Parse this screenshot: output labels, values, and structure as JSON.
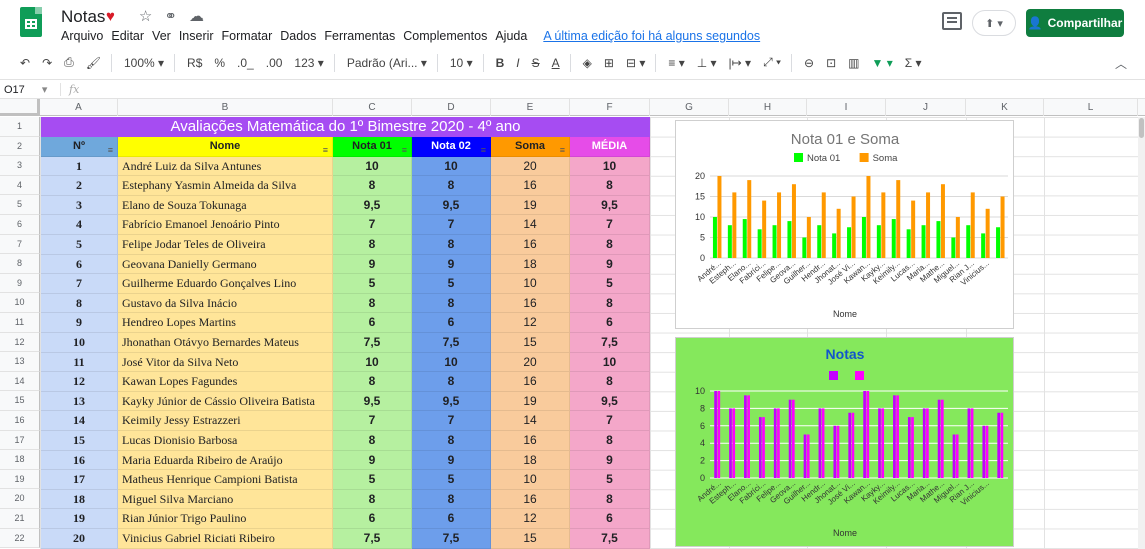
{
  "app": {
    "doc_title": "Notas",
    "menu": [
      "Arquivo",
      "Editar",
      "Ver",
      "Inserir",
      "Formatar",
      "Dados",
      "Ferramentas",
      "Complementos",
      "Ajuda"
    ],
    "last_edit": "A última edição foi há alguns segundos",
    "share_label": "Compartilhar"
  },
  "toolbar": {
    "zoom": "100%",
    "currency": "R$",
    "percent": "%",
    "dec_less": ".0_",
    "dec_more": ".00",
    "format_123": "123",
    "font": "Padrão (Ari...",
    "font_size": "10",
    "bold": "B",
    "italic": "I",
    "strike": "S",
    "underline_a": "A"
  },
  "formula_bar": {
    "cell_ref": "O17",
    "fx": "fx",
    "value": ""
  },
  "grid": {
    "columns": [
      "A",
      "B",
      "C",
      "D",
      "E",
      "F",
      "G",
      "H",
      "I",
      "J",
      "K",
      "L"
    ],
    "rows": [
      "1",
      "2",
      "3",
      "4",
      "5",
      "6",
      "7",
      "8",
      "9",
      "10",
      "11",
      "12",
      "13",
      "14",
      "15",
      "16",
      "17",
      "18",
      "19",
      "20",
      "21",
      "22"
    ]
  },
  "sheet": {
    "title": "Avaliações Matemática do 1º Bimestre 2020 -  4º ano",
    "headers": [
      "Nº",
      "Nome",
      "Nota 01",
      "Nota 02",
      "Soma",
      "MÉDIA"
    ],
    "students": [
      {
        "n": "1",
        "nome": "André Luiz da Silva Antunes",
        "n1": "10",
        "n2": "10",
        "soma": "20",
        "media": "10"
      },
      {
        "n": "2",
        "nome": "Estephany Yasmin Almeida da Silva",
        "n1": "8",
        "n2": "8",
        "soma": "16",
        "media": "8"
      },
      {
        "n": "3",
        "nome": "Elano de Souza Tokunaga",
        "n1": "9,5",
        "n2": "9,5",
        "soma": "19",
        "media": "9,5"
      },
      {
        "n": "4",
        "nome": "Fabrício Emanoel Jenoário Pinto",
        "n1": "7",
        "n2": "7",
        "soma": "14",
        "media": "7"
      },
      {
        "n": "5",
        "nome": "Felipe Jodar Teles de Oliveira",
        "n1": "8",
        "n2": "8",
        "soma": "16",
        "media": "8"
      },
      {
        "n": "6",
        "nome": "Geovana Danielly Germano",
        "n1": "9",
        "n2": "9",
        "soma": "18",
        "media": "9"
      },
      {
        "n": "7",
        "nome": "Guilherme Eduardo Gonçalves Lino",
        "n1": "5",
        "n2": "5",
        "soma": "10",
        "media": "5"
      },
      {
        "n": "8",
        "nome": "Gustavo da Silva Inácio",
        "n1": "8",
        "n2": "8",
        "soma": "16",
        "media": "8"
      },
      {
        "n": "9",
        "nome": "Hendreo Lopes Martins",
        "n1": "6",
        "n2": "6",
        "soma": "12",
        "media": "6"
      },
      {
        "n": "10",
        "nome": "Jhonathan Otávyo Bernardes Mateus",
        "n1": "7,5",
        "n2": "7,5",
        "soma": "15",
        "media": "7,5"
      },
      {
        "n": "11",
        "nome": "José Vitor da Silva Neto",
        "n1": "10",
        "n2": "10",
        "soma": "20",
        "media": "10"
      },
      {
        "n": "12",
        "nome": "Kawan Lopes Fagundes",
        "n1": "8",
        "n2": "8",
        "soma": "16",
        "media": "8"
      },
      {
        "n": "13",
        "nome": "Kayky Júnior de Cássio Oliveira Batista",
        "n1": "9,5",
        "n2": "9,5",
        "soma": "19",
        "media": "9,5"
      },
      {
        "n": "14",
        "nome": "Keimily Jessy Estrazzeri",
        "n1": "7",
        "n2": "7",
        "soma": "14",
        "media": "7"
      },
      {
        "n": "15",
        "nome": "Lucas Dionisio Barbosa",
        "n1": "8",
        "n2": "8",
        "soma": "16",
        "media": "8"
      },
      {
        "n": "16",
        "nome": "Maria Eduarda Ribeiro de Araújo",
        "n1": "9",
        "n2": "9",
        "soma": "18",
        "media": "9"
      },
      {
        "n": "17",
        "nome": "Matheus Henrique Campioni Batista",
        "n1": "5",
        "n2": "5",
        "soma": "10",
        "media": "5"
      },
      {
        "n": "18",
        "nome": "Miguel Silva Marciano",
        "n1": "8",
        "n2": "8",
        "soma": "16",
        "media": "8"
      },
      {
        "n": "19",
        "nome": "Rian Júnior Trigo Paulino",
        "n1": "6",
        "n2": "6",
        "soma": "12",
        "media": "6"
      },
      {
        "n": "20",
        "nome": "Vinicius Gabriel Riciati Ribeiro",
        "n1": "7,5",
        "n2": "7,5",
        "soma": "15",
        "media": "7,5"
      }
    ]
  },
  "colors": {
    "title_bg": "#a64cf2",
    "num_bg": "#c9daf8",
    "name_bg": "#ffe599",
    "n1_bg": "#b6f0a0",
    "n2_bg": "#6d9eeb",
    "soma_bg": "#f9cb9c",
    "media_bg": "#f4a7c9",
    "hdr_num": "#6fa8dc",
    "hdr_nome": "#ffff00",
    "hdr_n1": "#00ff00",
    "hdr_n2": "#0000ff",
    "hdr_soma": "#ff9900",
    "hdr_media": "#e64ce8",
    "series_green": "#00ff00",
    "series_orange": "#ff9900",
    "series_magenta": "#c300ff",
    "share_green": "#0f7d3f"
  },
  "chart_data": [
    {
      "type": "bar",
      "title": "Nota 01 e Soma",
      "xlabel": "Nome",
      "ylabel": "",
      "ylim": [
        0,
        20
      ],
      "yticks": [
        "0",
        "5",
        "10",
        "15",
        "20"
      ],
      "legend": "top",
      "grid": true,
      "categories": [
        "André...",
        "Esteph...",
        "Elano...",
        "Fabríci...",
        "Felipe...",
        "Geova...",
        "Guilher...",
        "Hendr...",
        "Jhonat...",
        "José Vi...",
        "Kawan...",
        "Kayky...",
        "Keimily...",
        "Lucas...",
        "Maria...",
        "Mathe...",
        "Miguel...",
        "Rian J...",
        "Vinicius..."
      ],
      "series": [
        {
          "name": "Nota 01",
          "color": "#00ff00",
          "values": [
            10,
            8,
            9.5,
            7,
            8,
            9,
            5,
            8,
            6,
            7.5,
            10,
            8,
            9.5,
            7,
            8,
            9,
            5,
            8,
            6,
            7.5
          ]
        },
        {
          "name": "Soma",
          "color": "#ff9900",
          "values": [
            20,
            16,
            19,
            14,
            16,
            18,
            10,
            16,
            12,
            15,
            20,
            16,
            19,
            14,
            16,
            18,
            10,
            16,
            12,
            15
          ]
        }
      ]
    },
    {
      "type": "bar",
      "title": "Notas",
      "xlabel": "Nome",
      "ylabel": "",
      "ylim": [
        0,
        10
      ],
      "yticks": [
        "0",
        "2",
        "4",
        "6",
        "8",
        "10"
      ],
      "legend": "top",
      "grid": true,
      "categories": [
        "André...",
        "Esteph...",
        "Elano...",
        "Fabríci...",
        "Felipe...",
        "Geova...",
        "Guilher...",
        "Hendr...",
        "Jhonat...",
        "José Vi...",
        "Kawan...",
        "Kayky...",
        "Keimily...",
        "Lucas...",
        "Maria...",
        "Mathe...",
        "Miguel...",
        "Rian J...",
        "Vinicius..."
      ],
      "series": [
        {
          "color": "#c300ff",
          "values": [
            10,
            8,
            9.5,
            7,
            8,
            9,
            5,
            8,
            6,
            7.5,
            10,
            8,
            9.5,
            7,
            8,
            9,
            5,
            8,
            6,
            7.5
          ]
        },
        {
          "color": "#ff00ff",
          "values": [
            10,
            8,
            9.5,
            7,
            8,
            9,
            5,
            8,
            6,
            7.5,
            10,
            8,
            9.5,
            7,
            8,
            9,
            5,
            8,
            6,
            7.5
          ]
        }
      ]
    }
  ]
}
